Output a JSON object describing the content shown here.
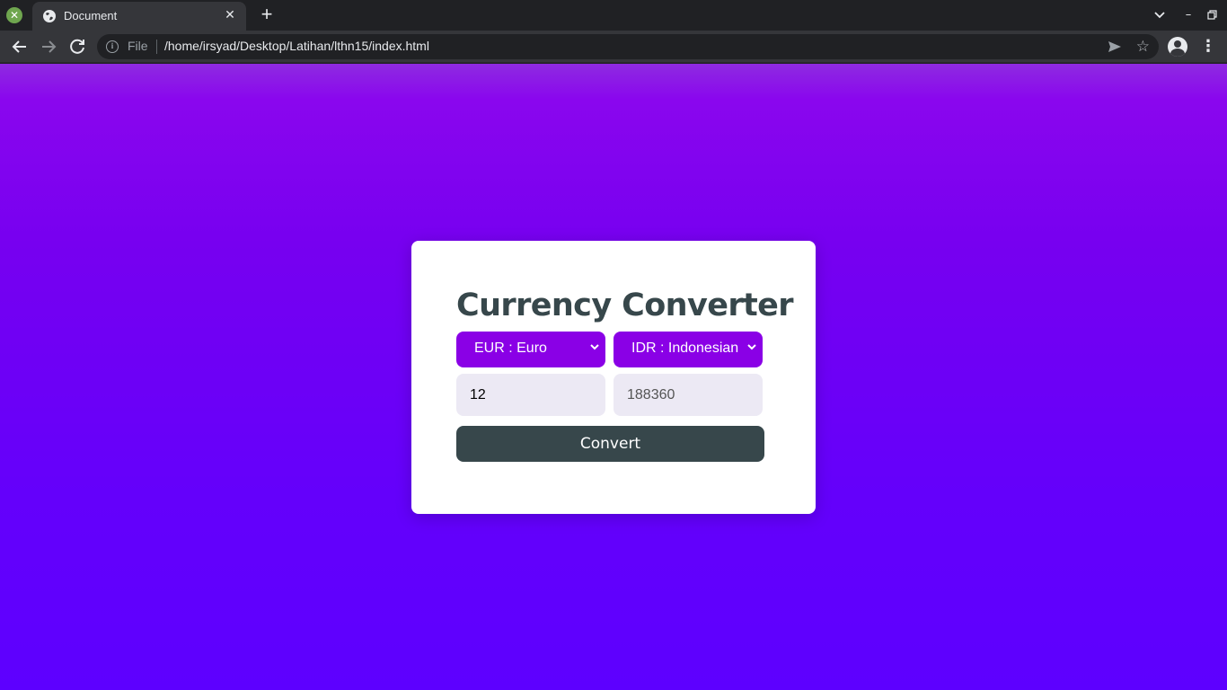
{
  "browser": {
    "tab": {
      "title": "Document"
    },
    "address_bar": {
      "scheme_label": "File",
      "url": "/home/irsyad/Desktop/Latihan/lthn15/index.html"
    }
  },
  "page": {
    "title": "Currency Converter",
    "from_currency": {
      "selected": "EUR : Euro"
    },
    "to_currency": {
      "selected": "IDR : Indonesian"
    },
    "amount_input": {
      "value": "12"
    },
    "result_input": {
      "value": "188360"
    },
    "convert_button": {
      "label": "Convert"
    }
  },
  "colors": {
    "accent_select": "#8a00e6",
    "button_dark": "#37474b",
    "background_top": "#8a06ee",
    "background_bottom": "#5d00ff"
  },
  "icons": [
    "close-icon",
    "globe-icon",
    "plus-icon",
    "chevron-down-icon",
    "minimize-icon",
    "maximize-icon",
    "back-arrow-icon",
    "forward-arrow-icon",
    "reload-icon",
    "info-icon",
    "send-icon",
    "star-icon",
    "profile-icon",
    "more-vert-icon"
  ]
}
